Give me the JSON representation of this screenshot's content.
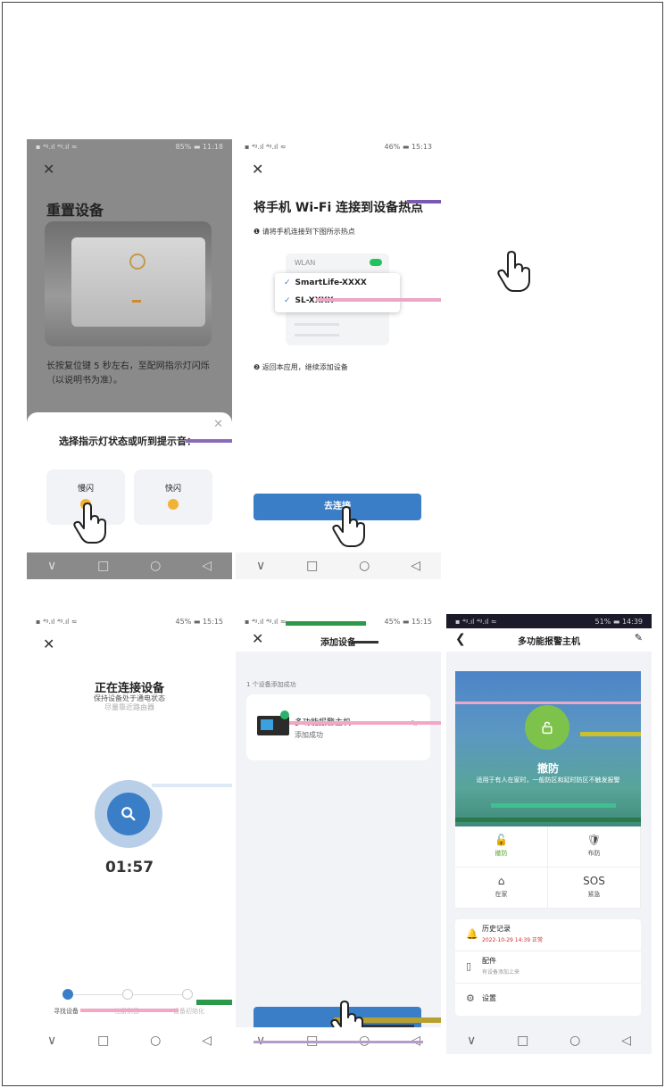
{
  "screens": {
    "reset": {
      "status_left": "▪ ⁴ᵍ.ıl ⁴ᵍ.ıl ≈",
      "status_right": "85% ▬ 11:18",
      "close": "✕",
      "title": "重置设备",
      "description": "长按复位键 5 秒左右，至配网指示灯闪烁（以说明书为准）。",
      "sheet_title": "选择指示灯状态或听到提示音：",
      "sheet_close": "✕",
      "option_slow": "慢闪",
      "option_fast": "快闪"
    },
    "connect_wifi": {
      "status_left": "▪ ⁴ᵍ.ıl ⁴ᵍ.ıl ≈",
      "status_right": "46% ▬ 15:13",
      "close": "✕",
      "title": "将手机 Wi-Fi 连接到设备热点",
      "step1": "❶ 请将手机连接到下图所示热点",
      "wlan_label": "WLAN",
      "hotspot1": "SmartLife-XXXX",
      "hotspot2": "SL-XXXX",
      "check": "✓",
      "step2": "❷ 返回本应用，继续添加设备",
      "button": "去连接"
    },
    "connecting": {
      "status_left": "▪ ⁴ᵍ.ıl ⁴ᵍ.ıl ≈",
      "status_right": "45% ▬ 15:15",
      "close": "✕",
      "title": "正在连接设备",
      "subtitle_line1": "保持设备处于通电状态",
      "subtitle_line2": "尽量靠近路由器",
      "timer": "01:57",
      "step_labels": [
        "寻找设备",
        "注册到云",
        "设备初始化"
      ]
    },
    "add_device": {
      "status_left": "▪ ⁴ᵍ.ıl ⁴ᵍ.ıl ≈",
      "status_right": "45% ▬ 15:15",
      "close": "✕",
      "title": "添加设备",
      "count": "1 个设备添加成功",
      "device_name": "多功能报警主机",
      "device_status": "添加成功",
      "edit": "✎"
    },
    "alarm_host": {
      "status_left": "▪ ⁴ᵍ.ıl ⁴ᵍ.ıl ≈",
      "status_right": "51% ▬ 14:39",
      "back": "❮",
      "title": "多功能报警主机",
      "edit": "✎",
      "mode": "撤防",
      "mode_desc": "适用于有人在家时，一般防区和延时防区不触发报警",
      "grid": [
        {
          "label": "撤防",
          "icon": "🔓"
        },
        {
          "label": "布防",
          "icon": "🛡"
        },
        {
          "label": "在家",
          "icon": "⌂"
        },
        {
          "label": "紧急",
          "icon": "SOS"
        }
      ],
      "menu": [
        {
          "icon": "🔔",
          "label": "历史记录",
          "sub": "2022-10-29 14:39 正常"
        },
        {
          "icon": "▯",
          "label": "配件",
          "sub": "有设备添加上来"
        },
        {
          "icon": "⚙",
          "label": "设置",
          "sub": ""
        }
      ]
    }
  },
  "nav": {
    "back": "∨",
    "home": "□",
    "circle": "○",
    "tri": "◁"
  },
  "colors": {
    "primary": "#3b7ec8",
    "green": "#7dc24b",
    "success": "#29b36a"
  }
}
